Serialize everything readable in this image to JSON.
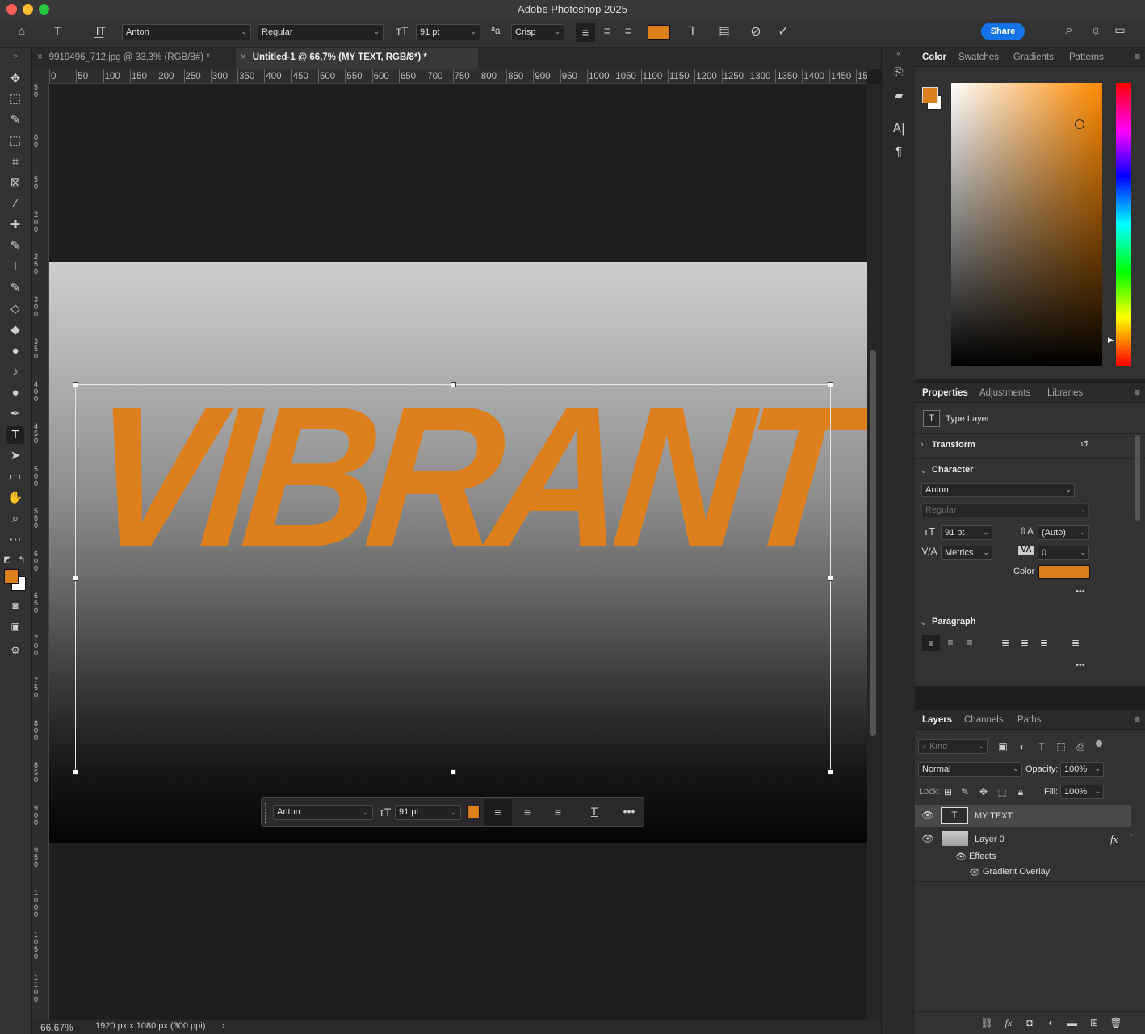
{
  "app": {
    "title": "Adobe Photoshop 2025"
  },
  "options": {
    "font_family": "Anton",
    "font_style": "Regular",
    "font_size": "91 pt",
    "antialias": "Crisp",
    "share_label": "Share",
    "text_color": "#de7f1e"
  },
  "tabs": [
    {
      "label": "9919496_712.jpg @ 33,3% (RGB/8#) *"
    },
    {
      "label": "Untitled-1 @ 66,7% (MY TEXT, RGB/8*) *"
    }
  ],
  "ruler": {
    "h": [
      "0",
      "50",
      "100",
      "150",
      "200",
      "250",
      "300",
      "350",
      "400",
      "450",
      "500",
      "550",
      "600",
      "650",
      "700",
      "750",
      "800",
      "850",
      "900",
      "950",
      "1000",
      "1050",
      "1100",
      "1150",
      "1200",
      "1250",
      "1300",
      "1350",
      "1400",
      "1450",
      "15"
    ],
    "v": [
      "50",
      "100",
      "150",
      "200",
      "250",
      "300",
      "350",
      "400",
      "450",
      "500",
      "550",
      "600",
      "650",
      "700",
      "750",
      "800",
      "850",
      "900",
      "950",
      "1000",
      "1050",
      "1100"
    ]
  },
  "canvas": {
    "text": "VIBRANT"
  },
  "ctxbar": {
    "font_family": "Anton",
    "font_size": "91 pt",
    "more": "•••"
  },
  "status": {
    "zoom": "66.67%",
    "doc_info": "1920 px x 1080 px (300 ppi)",
    "arrow": "›"
  },
  "color_panel": {
    "tabs": [
      "Color",
      "Swatches",
      "Gradients",
      "Patterns"
    ],
    "foreground": "#de7f1e",
    "background": "#ffffff"
  },
  "properties": {
    "tabs": [
      "Properties",
      "Adjustments",
      "Libraries"
    ],
    "layer_type": "Type Layer",
    "transform": "Transform",
    "character": "Character",
    "font": "Anton",
    "style": "Regular",
    "size": "91 pt",
    "leading": "(Auto)",
    "kerning": "Metrics",
    "tracking": "0",
    "color_label": "Color",
    "paragraph": "Paragraph",
    "more": "•••"
  },
  "layers": {
    "tabs": [
      "Layers",
      "Channels",
      "Paths"
    ],
    "kind": "Kind",
    "blend": "Normal",
    "opacity_label": "Opacity:",
    "opacity": "100%",
    "lock_label": "Lock:",
    "fill_label": "Fill:",
    "fill": "100%",
    "items": [
      "MY TEXT",
      "Layer 0"
    ],
    "effects": "Effects",
    "gradient_overlay": "Gradient Overlay",
    "fx": "fx"
  }
}
